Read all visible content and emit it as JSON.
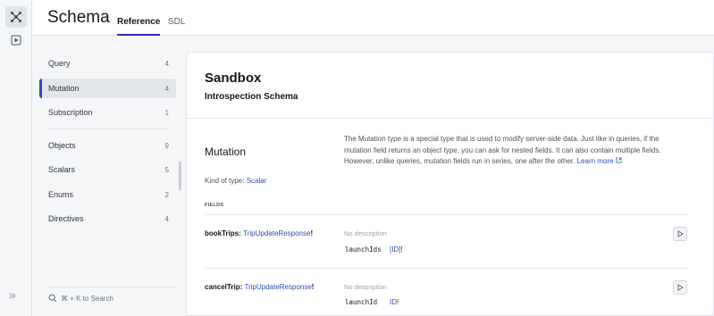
{
  "rail": {
    "icons": [
      "graph-icon",
      "play-panel-icon"
    ],
    "expand_icon": "double-chevron-right-icon"
  },
  "header": {
    "title": "Schema",
    "tabs": [
      {
        "label": "Reference",
        "active": true
      },
      {
        "label": "SDL",
        "active": false
      }
    ]
  },
  "sidebar": {
    "root_types": [
      {
        "label": "Query",
        "count": "4"
      },
      {
        "label": "Mutation",
        "count": "4",
        "active": true
      },
      {
        "label": "Subscription",
        "count": "1"
      }
    ],
    "groups": [
      {
        "label": "Objects",
        "count": "9"
      },
      {
        "label": "Scalars",
        "count": "5"
      },
      {
        "label": "Enums",
        "count": "2"
      },
      {
        "label": "Directives",
        "count": "4"
      }
    ],
    "search_label": "⌘ + K to Search"
  },
  "main": {
    "title": "Sandbox",
    "subtitle": "Introspection Schema",
    "type_name": "Mutation",
    "description": "The Mutation type is a special type that is used to modify server-side data. Just like in queries, if the mutation field returns an object type, you can ask for nested fields. It can also contain multiple fields. However, unlike queries, mutation fields run in series, one after the other.",
    "learn_more": "Learn more",
    "kind_label": "Kind of type:",
    "kind_value": "Scalar",
    "fields_label": "FIELDS",
    "fields": [
      {
        "name": "bookTrips",
        "colon": ":",
        "type": "TripUpdateResponse",
        "bang": "!",
        "description": "No description",
        "arg_name": "launchIds",
        "arg_type": "[ID]",
        "arg_bang": "!"
      },
      {
        "name": "cancelTrip",
        "colon": ":",
        "type": "TripUpdateResponse",
        "bang": "!",
        "description": "No description",
        "arg_name": "launchId",
        "arg_type": "ID",
        "arg_bang": "!"
      }
    ]
  },
  "colors": {
    "accent": "#3f20ba",
    "link": "#2d4bb8",
    "text": "#14171c"
  }
}
